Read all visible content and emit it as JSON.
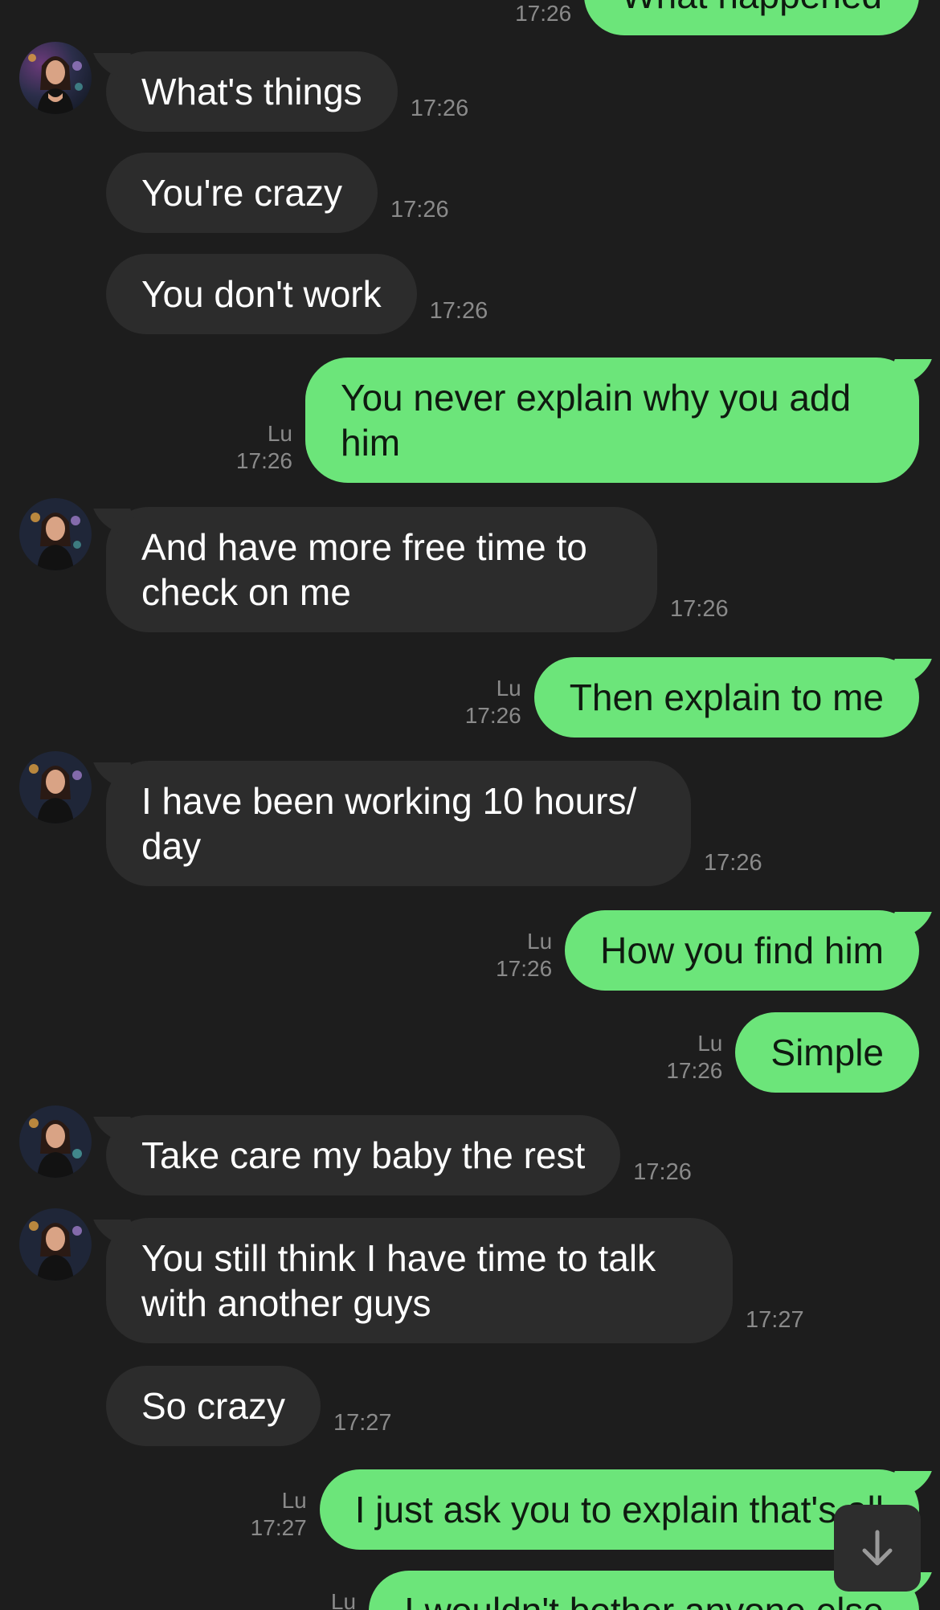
{
  "messages": [
    {
      "id": "m0",
      "side": "out",
      "text": "What happened",
      "sender": "",
      "time": "17:26"
    },
    {
      "id": "m1",
      "side": "in",
      "text": "What's things",
      "time": "17:26"
    },
    {
      "id": "m2",
      "side": "in",
      "text": "You're crazy",
      "time": "17:26"
    },
    {
      "id": "m3",
      "side": "in",
      "text": "You don't work",
      "time": "17:26"
    },
    {
      "id": "m4",
      "side": "out",
      "text": "You never explain why you add him",
      "sender": "Lu",
      "time": "17:26"
    },
    {
      "id": "m5",
      "side": "in",
      "text": "And have more free time to check on me",
      "time": "17:26"
    },
    {
      "id": "m6",
      "side": "out",
      "text": "Then explain to me",
      "sender": "Lu",
      "time": "17:26"
    },
    {
      "id": "m7",
      "side": "in",
      "text": "I have been working 10 hours/ day",
      "time": "17:26"
    },
    {
      "id": "m8",
      "side": "out",
      "text": "How you find him",
      "sender": "Lu",
      "time": "17:26"
    },
    {
      "id": "m9",
      "side": "out",
      "text": "Simple",
      "sender": "Lu",
      "time": "17:26"
    },
    {
      "id": "m10",
      "side": "in",
      "text": "Take care my baby the rest",
      "time": "17:26"
    },
    {
      "id": "m11",
      "side": "in",
      "text": "You still think I have time to talk with another guys",
      "time": "17:27"
    },
    {
      "id": "m12",
      "side": "in",
      "text": "So crazy",
      "time": "17:27"
    },
    {
      "id": "m13",
      "side": "out",
      "text": "I just ask you to explain that's all",
      "sender": "Lu",
      "time": "17:27"
    },
    {
      "id": "m14",
      "side": "out",
      "text": "I wouldn't bother anyone else",
      "sender": "Lu",
      "time": ""
    }
  ],
  "icons": {
    "avatar": "contact-avatar",
    "scroll_down": "arrow-down-icon"
  },
  "colors": {
    "background": "#1d1d1d",
    "incoming_bubble": "#2c2c2c",
    "outgoing_bubble": "#6ce57a",
    "timestamp": "#8a8a8a"
  }
}
